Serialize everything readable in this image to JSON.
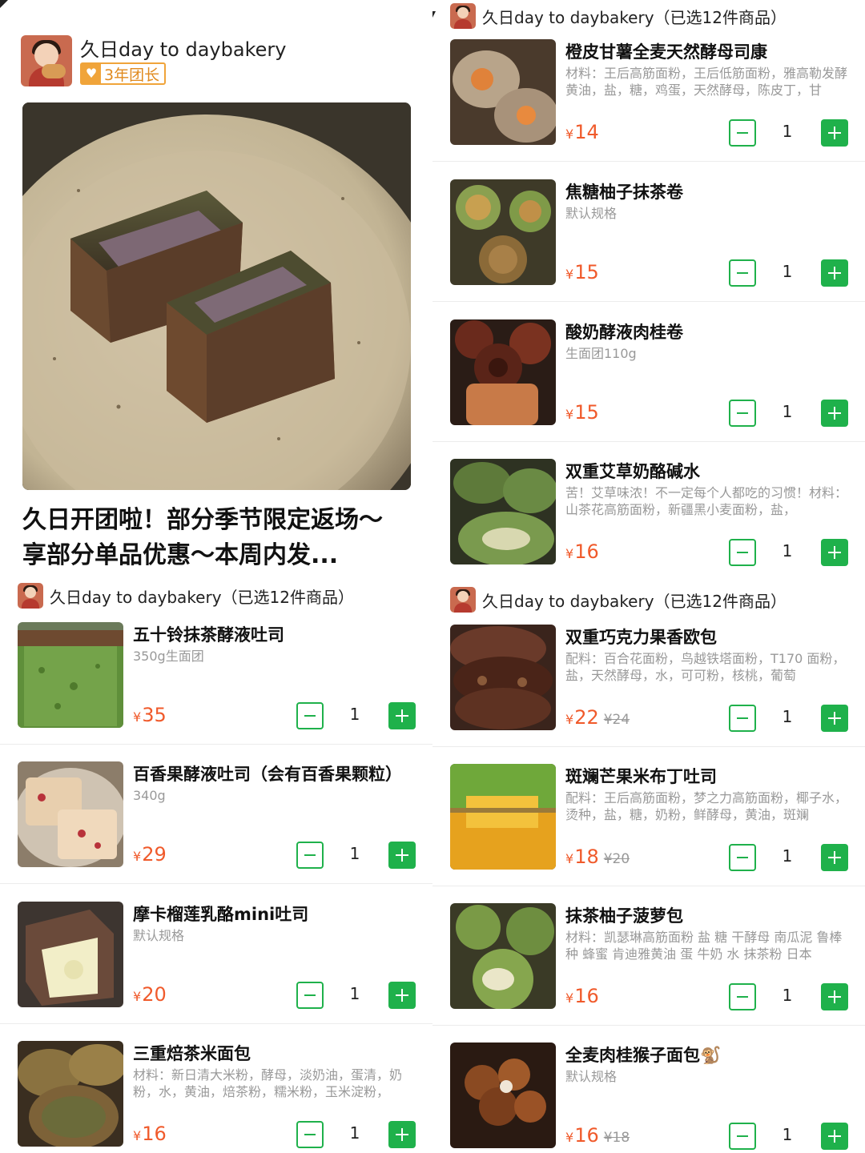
{
  "shop": {
    "name": "久日day to daybakery",
    "badge": "3年团长",
    "selected_line": "久日day to daybakery（已选12件商品）"
  },
  "headline": {
    "line1": "久日开团啦！部分季节限定返场～",
    "line2": "享部分单品优惠～本周内发..."
  },
  "currency": "¥",
  "colors": {
    "accent_green": "#1fb14b",
    "price_red": "#f05a2b",
    "badge_orange": "#f0a43a"
  },
  "left_products": [
    {
      "name": "五十铃抹茶酵液吐司",
      "desc": "350g生面团",
      "price": "35",
      "orig": "",
      "qty": "1"
    },
    {
      "name": "百香果酵液吐司（会有百香果颗粒）",
      "desc": "340g",
      "price": "29",
      "orig": "",
      "qty": "1"
    },
    {
      "name": "摩卡榴莲乳酪mini吐司",
      "desc": "默认规格",
      "price": "20",
      "orig": "",
      "qty": "1"
    },
    {
      "name": "三重焙茶米面包",
      "desc": "材料：新日清大米粉，酵母，淡奶油，蛋清，奶粉，水，黄油，焙茶粉，糯米粉，玉米淀粉，",
      "price": "16",
      "orig": "",
      "qty": "1"
    }
  ],
  "right_products_top": [
    {
      "name": "橙皮甘薯全麦天然酵母司康",
      "desc": "材料：王后高筋面粉，王后低筋面粉，雅高勒发酵黄油，盐，糖，鸡蛋，天然酵母，陈皮丁，甘",
      "price": "14",
      "orig": "",
      "qty": "1"
    },
    {
      "name": "焦糖柚子抹茶卷",
      "desc": "默认规格",
      "price": "15",
      "orig": "",
      "qty": "1"
    },
    {
      "name": "酸奶酵液肉桂卷",
      "desc": "生面团110g",
      "price": "15",
      "orig": "",
      "qty": "1"
    },
    {
      "name": "双重艾草奶酪碱水",
      "desc": "苦！艾草味浓！不一定每个人都吃的习惯！材料：山茶花高筋面粉，新疆黑小麦面粉，盐，",
      "price": "16",
      "orig": "",
      "qty": "1"
    }
  ],
  "right_products_bottom": [
    {
      "name": "双重巧克力果香欧包",
      "desc": "配料：百合花面粉，鸟越铁塔面粉，T170 面粉，盐，天然酵母，水，可可粉，核桃，葡萄",
      "price": "22",
      "orig": "¥24",
      "qty": "1"
    },
    {
      "name": "斑斓芒果米布丁吐司",
      "desc": "配料：王后高筋面粉，梦之力高筋面粉，椰子水，烫种，盐，糖，奶粉，鲜酵母，黄油，斑斓",
      "price": "18",
      "orig": "¥20",
      "qty": "1"
    },
    {
      "name": "抹茶柚子菠萝包",
      "desc": "材料：凯瑟琳高筋面粉 盐 糖 干酵母 南瓜泥 鲁棒种 蜂蜜 肯迪雅黄油 蛋 牛奶 水 抹茶粉 日本",
      "price": "16",
      "orig": "",
      "qty": "1"
    },
    {
      "name": "全麦肉桂猴子面包🐒",
      "desc": "默认规格",
      "price": "16",
      "orig": "¥18",
      "qty": "1"
    }
  ]
}
